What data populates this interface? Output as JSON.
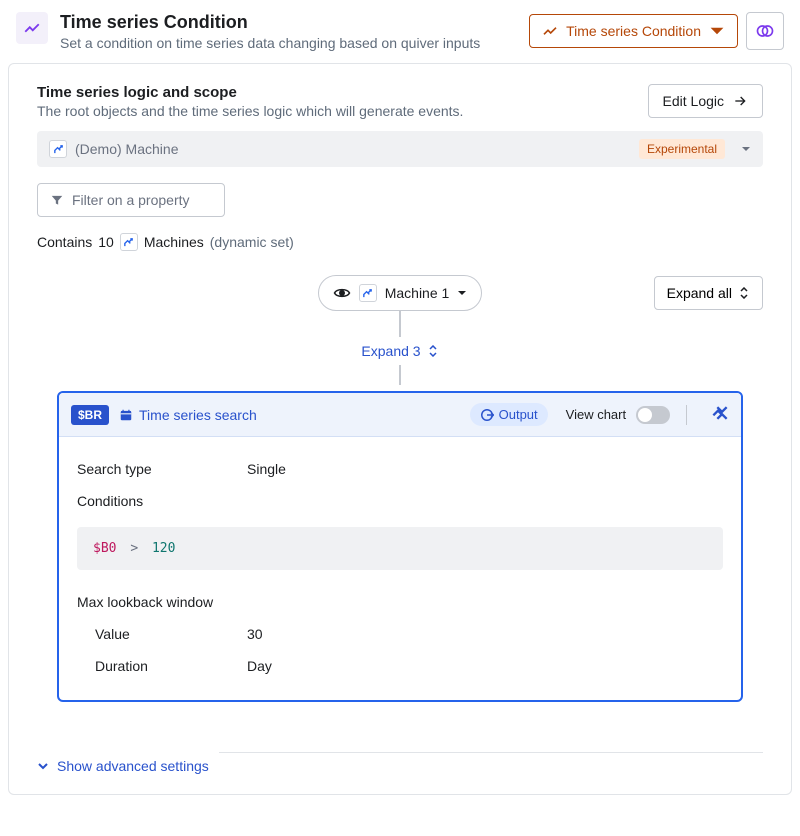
{
  "header": {
    "title": "Time series Condition",
    "subtitle": "Set a condition on time series data changing based on quiver inputs",
    "dropdown_label": "Time series Condition"
  },
  "logicSection": {
    "title": "Time series logic and scope",
    "subtitle": "The root objects and the time series logic which will generate events.",
    "edit_button": "Edit Logic"
  },
  "machineBar": {
    "name": "(Demo) Machine",
    "badge": "Experimental"
  },
  "filter": {
    "placeholder": "Filter on a property"
  },
  "contains": {
    "prefix": "Contains",
    "count": "10",
    "label": "Machines",
    "suffix": "(dynamic set)"
  },
  "tree": {
    "machine_label": "Machine 1",
    "expand_all": "Expand all",
    "expand_n": "Expand 3"
  },
  "tsCard": {
    "tag": "$BR",
    "title": "Time series search",
    "output_chip": "Output",
    "view_chart": "View chart",
    "search_type_label": "Search type",
    "search_type_value": "Single",
    "conditions_label": "Conditions",
    "expr_var": "$B0",
    "expr_op": ">",
    "expr_val": "120",
    "lookback_label": "Max lookback window",
    "value_label": "Value",
    "value_value": "30",
    "duration_label": "Duration",
    "duration_value": "Day"
  },
  "advanced": {
    "label": "Show advanced settings"
  }
}
